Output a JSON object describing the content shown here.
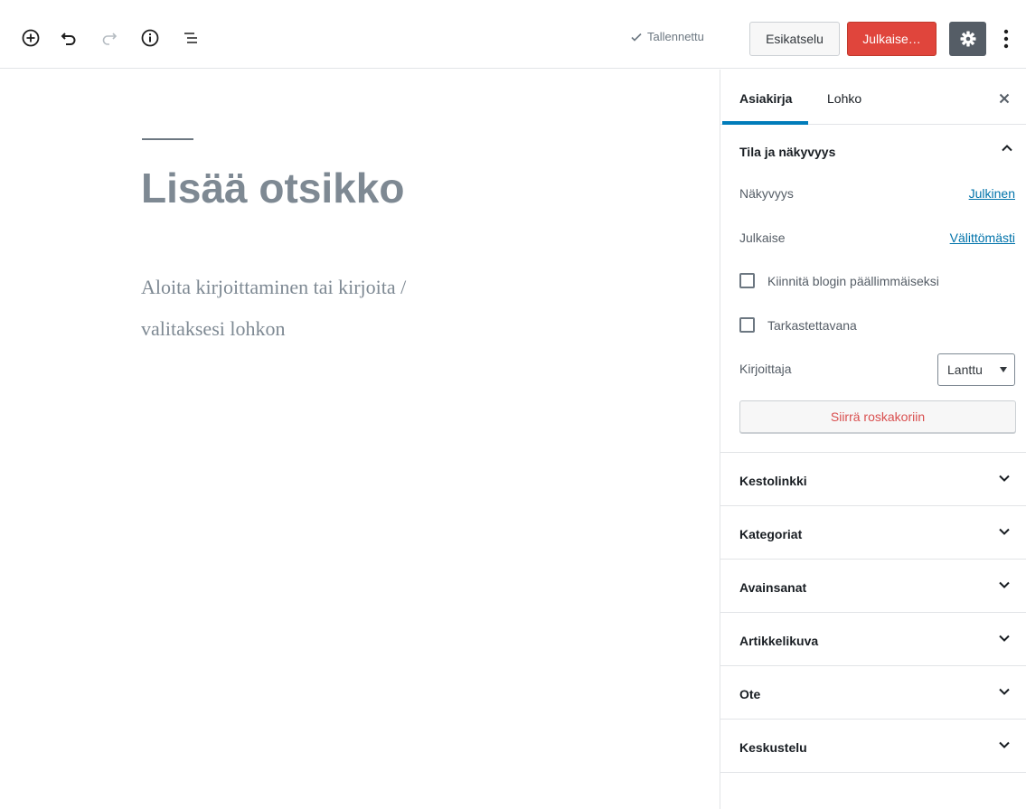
{
  "toolbar": {
    "saved_label": "Tallennettu",
    "preview_label": "Esikatselu",
    "publish_label": "Julkaise…",
    "colors": {
      "publish": "#e0453c",
      "settings": "#555d66"
    }
  },
  "editor": {
    "title_placeholder": "Lisää otsikko",
    "body_placeholder": "Aloita kirjoittaminen tai kirjoita / valitaksesi lohkon"
  },
  "sidebar": {
    "tabs": {
      "document": "Asiakirja",
      "block": "Lohko"
    },
    "status_panel": {
      "title": "Tila ja näkyvyys",
      "visibility_label": "Näkyvyys",
      "visibility_value": "Julkinen",
      "publish_label": "Julkaise",
      "publish_value": "Välittömästi",
      "sticky_label": "Kiinnitä blogin päällimmäiseksi",
      "pending_label": "Tarkastettavana",
      "author_label": "Kirjoittaja",
      "author_value": "Lanttu",
      "trash_label": "Siirrä roskakoriin"
    },
    "panels": [
      {
        "title": "Kestolinkki"
      },
      {
        "title": "Kategoriat"
      },
      {
        "title": "Avainsanat"
      },
      {
        "title": "Artikkelikuva"
      },
      {
        "title": "Ote"
      },
      {
        "title": "Keskustelu"
      }
    ]
  }
}
